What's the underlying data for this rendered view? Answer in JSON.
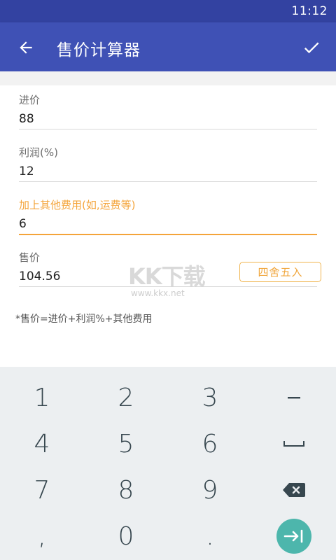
{
  "status_bar": {
    "time": "11:12"
  },
  "app_bar": {
    "title": "售价计算器"
  },
  "fields": [
    {
      "label": "进价",
      "value": "88"
    },
    {
      "label": "利润(%)",
      "value": "12"
    },
    {
      "label": "加上其他费用(如,运费等)",
      "value": "6"
    },
    {
      "label": "售价",
      "value": "104.56"
    }
  ],
  "round_button": {
    "label": "四舍五入"
  },
  "formula_note": "*售价=进价+利润%+其他费用",
  "watermark": {
    "big": "KK下载",
    "small": "www.kkx.net"
  },
  "keypad": {
    "keys": [
      "1",
      "2",
      "3",
      "–",
      "4",
      "5",
      "6",
      "␣",
      "7",
      "8",
      "9",
      "⌫",
      ",",
      "0",
      ".",
      "⇥"
    ]
  },
  "colors": {
    "primary": "#3f51b5",
    "primary_dark": "#3342a1",
    "accent": "#f4a43a",
    "keypad_bg": "#eceff1",
    "enter_key": "#4db6ac"
  }
}
